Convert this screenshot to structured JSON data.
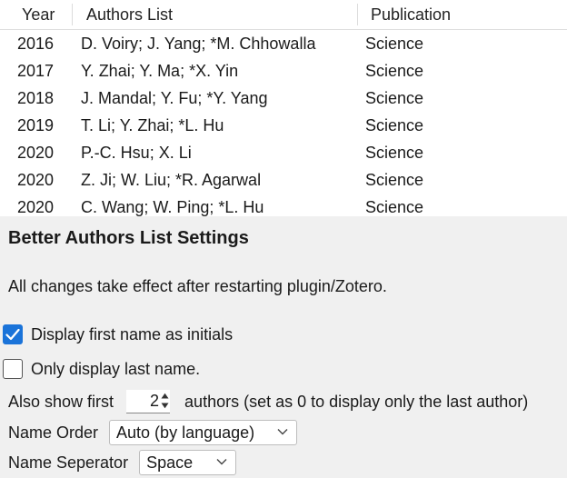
{
  "table": {
    "columns": {
      "year": "Year",
      "authors": "Authors List",
      "publication": "Publication"
    },
    "rows": [
      {
        "year": "2016",
        "authors": "D. Voiry; J. Yang; *M. Chhowalla",
        "publication": "Science"
      },
      {
        "year": "2017",
        "authors": "Y. Zhai; Y. Ma; *X. Yin",
        "publication": "Science"
      },
      {
        "year": "2018",
        "authors": "J. Mandal; Y. Fu; *Y. Yang",
        "publication": "Science"
      },
      {
        "year": "2019",
        "authors": "T. Li; Y. Zhai; *L. Hu",
        "publication": "Science"
      },
      {
        "year": "2020",
        "authors": "P.-C. Hsu; X. Li",
        "publication": "Science"
      },
      {
        "year": "2020",
        "authors": "Z. Ji; W. Liu; *R. Agarwal",
        "publication": "Science"
      },
      {
        "year": "2020",
        "authors": "C. Wang; W. Ping; *L. Hu",
        "publication": "Science"
      }
    ]
  },
  "settings": {
    "title": "Better Authors List Settings",
    "note": "All changes take effect after restarting plugin/Zotero.",
    "initials_label": "Display first name as initials",
    "initials_checked": true,
    "last_name_label": "Only display last name.",
    "last_name_checked": false,
    "show_first_prefix": "Also show first",
    "show_first_value": "2",
    "show_first_suffix": "authors (set as 0 to display only the last author)",
    "name_order_label": "Name Order",
    "name_order_value": "Auto (by language)",
    "separator_label": "Name Seperator",
    "separator_value": "Space"
  },
  "colors": {
    "accent": "#1a73d9",
    "panel_bg": "#f0f0f0"
  },
  "icons": {
    "check": "checkmark-icon",
    "dropdown": "chevron-down-icon",
    "spinner": "spinner-arrows-icon"
  }
}
